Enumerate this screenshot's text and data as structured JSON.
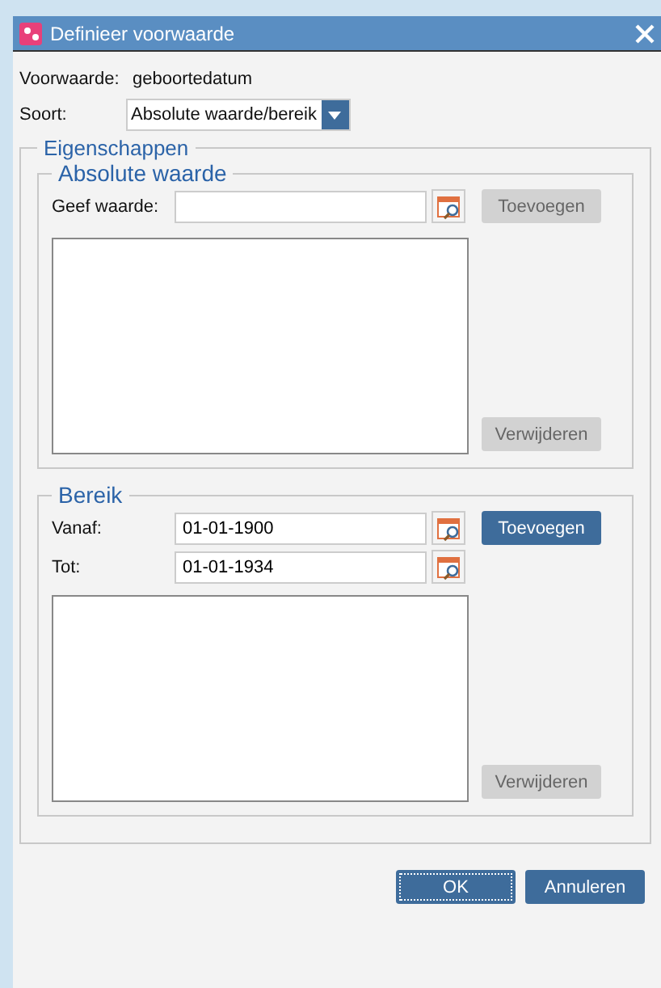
{
  "window": {
    "title": "Definieer voorwaarde"
  },
  "condition": {
    "label": "Voorwaarde:",
    "value": "geboortedatum"
  },
  "sort": {
    "label": "Soort:",
    "value": "Absolute waarde/bereik"
  },
  "properties": {
    "title": "Eigenschappen",
    "absolute": {
      "title": "Absolute waarde",
      "fields": [
        {
          "label": "Geef waarde:"
        }
      ],
      "add": {
        "label": "Toevoegen",
        "disabled": true
      },
      "remove": {
        "label": "Verwijderen",
        "disabled": true
      }
    },
    "range": {
      "title": "Bereik",
      "fields": [
        {
          "label": "Vanaf:",
          "value": "01-01-1900"
        },
        {
          "label": "Tot:",
          "value": "01-01-1934"
        }
      ],
      "add": {
        "label": "Toevoegen",
        "disabled": false
      },
      "remove": {
        "label": "Verwijderen",
        "disabled": true
      }
    }
  },
  "buttons": [
    {
      "label": "OK",
      "focused": true
    },
    {
      "label": "Annuleren",
      "focused": false
    }
  ]
}
